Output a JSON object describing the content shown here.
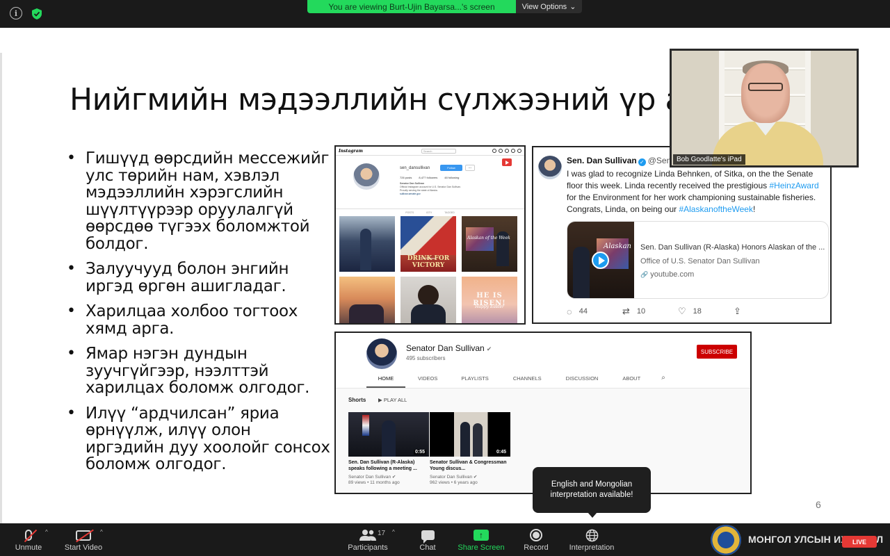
{
  "banner": {
    "viewing_text": "You are viewing Burt-Ujin Bayarsa...'s screen",
    "view_options_label": "View Options",
    "view_options_caret": "⌄",
    "accent_color": "#23d95c"
  },
  "slide": {
    "title": "Нийгмийн мэдээллийн сүлжээний үр аш",
    "bullets": [
      "Гишүүд өөрсдийн мессежийг улс төрийн нам, хэвлэл мэдээллийн хэрэгслийн шүүлтүүрээр оруулалгүй өөрсдөө түгээх боломжтой болдог.",
      "Залуучууд болон энгийн иргэд өргөн ашигладаг.",
      "Харилцаа холбоо тогтоох хямд арга.",
      "Ямар нэгэн дундын зуучгүйгээр, нээлттэй харилцах боломж олгодог.",
      "Илүү “ардчилсан” яриа өрнүүлж, илүү олон иргэдийн дуу хоолойг сонсох боломж олгодог."
    ],
    "page_number": "6"
  },
  "instagram": {
    "logo": "Instagram",
    "search_placeholder": "Search",
    "username": "sen_dansullivan",
    "follow_label": "Follow",
    "more_label": "...",
    "stats": {
      "posts": "726 posts",
      "followers": "8,477 followers",
      "following": "48 following"
    },
    "bio_name": "Senator Dan Sullivan",
    "bio_text": "Official Instagram account for U.S. Senator Dan Sullivan. Proudly serving the state of Alaska.",
    "bio_link": "sullivan.senate.gov",
    "tabs": [
      "POSTS",
      "IGTV",
      "TAGGED"
    ],
    "post2_caption_top": "This Summer",
    "post2_caption": "DRINK FOR VICTORY",
    "post3_caption": "Alaskan of the Week",
    "post6_caption": "HE IS RISEN!",
    "post6_sub": "Happy Easter"
  },
  "tweet": {
    "name": "Sen. Dan Sullivan",
    "verified": "✓",
    "handle": "@SenDanSullivan",
    "text_1": "I was glad to recognize Linda Behnken, of Sitka, on the the Senate floor this week. Linda recently received the prestigious ",
    "tag_1": "#HeinzAward",
    "text_2": " for the Environment for her work championing sustainable fisheries. Congrats, Linda, on being our ",
    "tag_2": "#AlaskanoftheWeek",
    "text_3": "!",
    "card_title": "Sen. Dan Sullivan (R-Alaska) Honors Alaskan of the ...",
    "card_channel": "Office of U.S. Senator Dan Sullivan",
    "card_link": "youtube.com",
    "link_icon": "🔗",
    "thumb_caption": "Alaskan",
    "replies": "44",
    "retweets": "10",
    "likes": "18",
    "reply_icon": "💬",
    "retweet_icon": "⇄",
    "like_icon": "♡",
    "share_icon": "⇪",
    "link_color": "#1d9bf0"
  },
  "youtube": {
    "channel_name": "Senator Dan Sullivan",
    "verified": "✔",
    "subscribers": "495 subscribers",
    "subscribe_label": "SUBSCRIBE",
    "tabs": [
      "HOME",
      "VIDEOS",
      "PLAYLISTS",
      "CHANNELS",
      "DISCUSSION",
      "ABOUT"
    ],
    "search_icon": "🔍",
    "shorts_label": "Shorts",
    "play_all_label": "▶  PLAY ALL",
    "videos": [
      {
        "title": "Sen. Dan Sullivan (R-Alaska) speaks following a meeting ...",
        "channel": "Senator Dan Sullivan ✔",
        "meta": "89 views • 11 months ago",
        "duration": "0:55"
      },
      {
        "title": "Senator Sullivan & Congressman Young discus...",
        "channel": "Senator Dan Sullivan ✔",
        "meta": "962 views • 6 years ago",
        "duration": "0:45"
      }
    ],
    "subscribe_color": "#cc0000"
  },
  "video_tile": {
    "participant_label": "Bob Goodlatte's iPad"
  },
  "tooltip": {
    "text": "English and Mongolian interpretation available!"
  },
  "toolbar": {
    "unmute_label": "Unmute",
    "start_video_label": "Start Video",
    "participants_label": "Participants",
    "participants_count": "17",
    "chat_label": "Chat",
    "share_screen_label": "Share Screen",
    "record_label": "Record",
    "interpretation_label": "Interpretation",
    "caret": "^",
    "people_icon": "👥",
    "share_glyph": "↑",
    "globe_icon": "🌐"
  },
  "watermark": {
    "text": "МОНГОЛ УЛСЫН ИХ ХУРАЛ",
    "badge": "LIVE"
  }
}
